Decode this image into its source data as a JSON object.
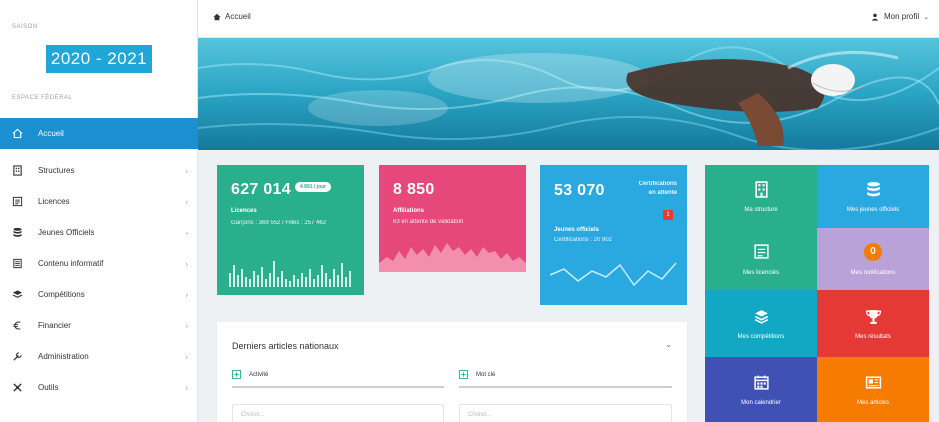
{
  "sidebar": {
    "season_label": "SAISON",
    "season": "2020 - 2021",
    "space_label": "ESPACE FÉDÉRAL",
    "items": [
      {
        "label": "Accueil",
        "active": true,
        "icon": "home-icon"
      },
      {
        "label": "Structures",
        "icon": "building-icon"
      },
      {
        "label": "Licences",
        "icon": "id-card-icon"
      },
      {
        "label": "Jeunes Officiels",
        "icon": "database-icon"
      },
      {
        "label": "Contenu informatif",
        "icon": "document-icon"
      },
      {
        "label": "Compétitions",
        "icon": "layers-icon"
      },
      {
        "label": "Financier",
        "icon": "euro-icon"
      },
      {
        "label": "Administration",
        "icon": "wrench-icon"
      },
      {
        "label": "Outils",
        "icon": "tools-icon"
      }
    ]
  },
  "topbar": {
    "breadcrumb": "Accueil",
    "profile": "Mon profil"
  },
  "cards": {
    "licences": {
      "value": "627 014",
      "badge": "4 891 / jour",
      "label": "Licences",
      "detail": "Garçons : 369 552 / Filles : 257 462"
    },
    "affiliations": {
      "value": "8 850",
      "label": "Affiliations",
      "detail": "63 en attente de validation"
    },
    "jeunes": {
      "value": "53 070",
      "certif_line1": "Certifications",
      "certif_line2": "en attente",
      "badge": "1",
      "label": "Jeunes officiels",
      "detail": "Certifications : 20 902"
    }
  },
  "tiles": [
    {
      "label": "Ma structure",
      "icon": "building-icon",
      "color": "#2aaf8d"
    },
    {
      "label": "Mes jeunes officiels",
      "icon": "database-icon",
      "color": "#2aa9e0"
    },
    {
      "label": "Mes licenciés",
      "icon": "id-card-icon",
      "color": "#2aaf8d"
    },
    {
      "label": "Mes notifications",
      "icon": "notification-icon",
      "color": "#b9a2d8"
    },
    {
      "label": "Mes compétitions",
      "icon": "layers-icon",
      "color": "#12a8c4"
    },
    {
      "label": "Mes résultats",
      "icon": "trophy-icon",
      "color": "#e53935"
    },
    {
      "label": "Mon calendrier",
      "icon": "calendar-icon",
      "color": "#3f51b5"
    },
    {
      "label": "Mes articles",
      "icon": "newspaper-icon",
      "color": "#f57c00"
    }
  ],
  "notification_count": "0",
  "articles": {
    "title": "Derniers articles nationaux",
    "tab1": "Activité",
    "tab2": "Mot clé",
    "placeholder1": "Choisir...",
    "placeholder2": "Choisir..."
  }
}
